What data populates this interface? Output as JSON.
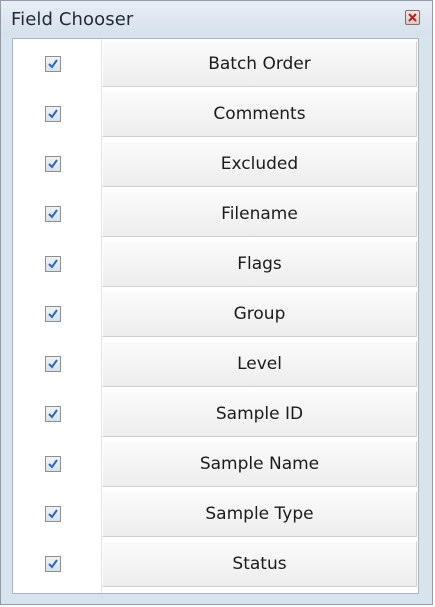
{
  "window": {
    "title": "Field Chooser",
    "close_icon": "close-icon"
  },
  "fields": [
    {
      "label": "Batch Order",
      "checked": true
    },
    {
      "label": "Comments",
      "checked": true
    },
    {
      "label": "Excluded",
      "checked": true
    },
    {
      "label": "Filename",
      "checked": true
    },
    {
      "label": "Flags",
      "checked": true
    },
    {
      "label": "Group",
      "checked": true
    },
    {
      "label": "Level",
      "checked": true
    },
    {
      "label": "Sample ID",
      "checked": true
    },
    {
      "label": "Sample Name",
      "checked": true
    },
    {
      "label": "Sample Type",
      "checked": true
    },
    {
      "label": "Status",
      "checked": true
    }
  ],
  "colors": {
    "titlebar": "#d9e3ee",
    "check_blue": "#2f67b3",
    "close_red": "#b22222"
  }
}
